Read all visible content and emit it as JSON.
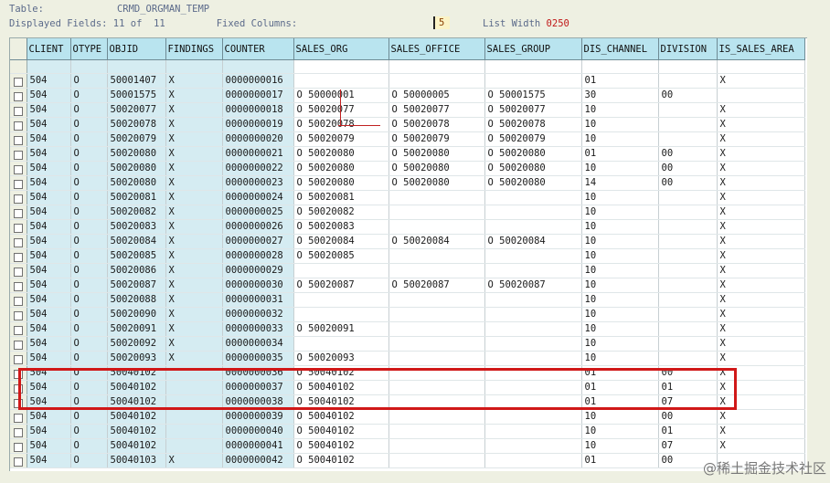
{
  "header": {
    "table_label": "Table:",
    "table_name": "CRMD_ORGMAN_TEMP",
    "displayed_label": "Displayed Fields:",
    "displayed_value": "11 of  11",
    "fixed_label": "Fixed Columns:",
    "fixed_value": "5",
    "list_width_label": "List Width",
    "list_width_value": "0250"
  },
  "columns": [
    "CLIENT",
    "OTYPE",
    "OBJID",
    "FINDINGS",
    "COUNTER",
    "SALES_ORG",
    "SALES_OFFICE",
    "SALES_GROUP",
    "DIS_CHANNEL",
    "DIVISION",
    "IS_SALES_AREA"
  ],
  "rows": [
    [
      "504",
      "O",
      "50001407",
      "X",
      "0000000016",
      "",
      "",
      "",
      "01",
      "",
      "X"
    ],
    [
      "504",
      "O",
      "50001575",
      "X",
      "0000000017",
      "O 50000001",
      "O 50000005",
      "O 50001575",
      "30",
      "00",
      ""
    ],
    [
      "504",
      "O",
      "50020077",
      "X",
      "0000000018",
      "O 50020077",
      "O 50020077",
      "O 50020077",
      "10",
      "",
      "X"
    ],
    [
      "504",
      "O",
      "50020078",
      "X",
      "0000000019",
      "O 50020078",
      "O 50020078",
      "O 50020078",
      "10",
      "",
      "X"
    ],
    [
      "504",
      "O",
      "50020079",
      "X",
      "0000000020",
      "O 50020079",
      "O 50020079",
      "O 50020079",
      "10",
      "",
      "X"
    ],
    [
      "504",
      "O",
      "50020080",
      "X",
      "0000000021",
      "O 50020080",
      "O 50020080",
      "O 50020080",
      "01",
      "00",
      "X"
    ],
    [
      "504",
      "O",
      "50020080",
      "X",
      "0000000022",
      "O 50020080",
      "O 50020080",
      "O 50020080",
      "10",
      "00",
      "X"
    ],
    [
      "504",
      "O",
      "50020080",
      "X",
      "0000000023",
      "O 50020080",
      "O 50020080",
      "O 50020080",
      "14",
      "00",
      "X"
    ],
    [
      "504",
      "O",
      "50020081",
      "X",
      "0000000024",
      "O 50020081",
      "",
      "",
      "10",
      "",
      "X"
    ],
    [
      "504",
      "O",
      "50020082",
      "X",
      "0000000025",
      "O 50020082",
      "",
      "",
      "10",
      "",
      "X"
    ],
    [
      "504",
      "O",
      "50020083",
      "X",
      "0000000026",
      "O 50020083",
      "",
      "",
      "10",
      "",
      "X"
    ],
    [
      "504",
      "O",
      "50020084",
      "X",
      "0000000027",
      "O 50020084",
      "O 50020084",
      "O 50020084",
      "10",
      "",
      "X"
    ],
    [
      "504",
      "O",
      "50020085",
      "X",
      "0000000028",
      "O 50020085",
      "",
      "",
      "10",
      "",
      "X"
    ],
    [
      "504",
      "O",
      "50020086",
      "X",
      "0000000029",
      "",
      "",
      "",
      "10",
      "",
      "X"
    ],
    [
      "504",
      "O",
      "50020087",
      "X",
      "0000000030",
      "O 50020087",
      "O 50020087",
      "O 50020087",
      "10",
      "",
      "X"
    ],
    [
      "504",
      "O",
      "50020088",
      "X",
      "0000000031",
      "",
      "",
      "",
      "10",
      "",
      "X"
    ],
    [
      "504",
      "O",
      "50020090",
      "X",
      "0000000032",
      "",
      "",
      "",
      "10",
      "",
      "X"
    ],
    [
      "504",
      "O",
      "50020091",
      "X",
      "0000000033",
      "O 50020091",
      "",
      "",
      "10",
      "",
      "X"
    ],
    [
      "504",
      "O",
      "50020092",
      "X",
      "0000000034",
      "",
      "",
      "",
      "10",
      "",
      "X"
    ],
    [
      "504",
      "O",
      "50020093",
      "X",
      "0000000035",
      "O 50020093",
      "",
      "",
      "10",
      "",
      "X"
    ],
    [
      "504",
      "O",
      "50040102",
      "",
      "0000000036",
      "O 50040102",
      "",
      "",
      "01",
      "00",
      "X"
    ],
    [
      "504",
      "O",
      "50040102",
      "",
      "0000000037",
      "O 50040102",
      "",
      "",
      "01",
      "01",
      "X"
    ],
    [
      "504",
      "O",
      "50040102",
      "",
      "0000000038",
      "O 50040102",
      "",
      "",
      "01",
      "07",
      "X"
    ],
    [
      "504",
      "O",
      "50040102",
      "",
      "0000000039",
      "O 50040102",
      "",
      "",
      "10",
      "00",
      "X"
    ],
    [
      "504",
      "O",
      "50040102",
      "",
      "0000000040",
      "O 50040102",
      "",
      "",
      "10",
      "01",
      "X"
    ],
    [
      "504",
      "O",
      "50040102",
      "",
      "0000000041",
      "O 50040102",
      "",
      "",
      "10",
      "07",
      "X"
    ],
    [
      "504",
      "O",
      "50040103",
      "X",
      "0000000042",
      "O 50040102",
      "",
      "",
      "01",
      "00",
      ""
    ]
  ],
  "watermark": "@稀土掘金技术社区"
}
